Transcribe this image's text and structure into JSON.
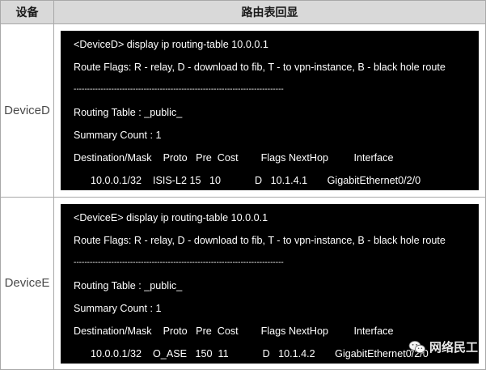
{
  "table": {
    "header": {
      "device_col": "设备",
      "output_col": "路由表回显"
    },
    "rows": [
      {
        "device": "DeviceD",
        "lines": [
          "<DeviceD> display ip routing-table 10.0.0.1",
          "Route Flags: R - relay, D - download to fib, T - to vpn-instance, B - black hole route",
          "------------------------------------------------------------------------------",
          "Routing Table : _public_",
          "Summary Count : 1",
          "Destination/Mask    Proto   Pre  Cost        Flags NextHop         Interface",
          "      10.0.0.1/32    ISIS-L2 15   10            D   10.1.4.1       GigabitEthernet0/2/0"
        ]
      },
      {
        "device": "DeviceE",
        "lines": [
          "<DeviceE> display ip routing-table 10.0.0.1",
          "Route Flags: R - relay, D - download to fib, T - to vpn-instance, B - black hole route",
          "------------------------------------------------------------------------------",
          "Routing Table : _public_",
          "Summary Count : 1",
          "Destination/Mask    Proto   Pre  Cost        Flags NextHop         Interface",
          "      10.0.0.1/32    O_ASE   150  11            D   10.1.4.2       GigabitEthernet0/2/0"
        ]
      }
    ]
  },
  "watermark": {
    "text": "网络民工",
    "icon": "wechat-icon"
  }
}
